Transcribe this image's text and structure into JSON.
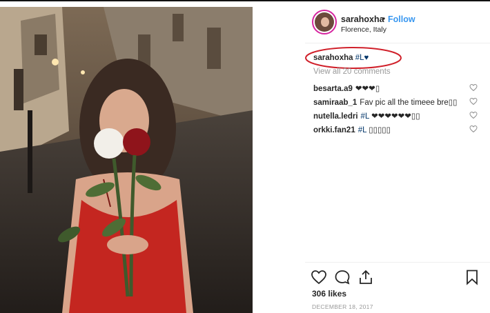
{
  "post": {
    "username": "sarahoxha",
    "follow_label": "Follow",
    "separator": "•",
    "location": "Florence, Italy",
    "caption": {
      "username": "sarahoxha",
      "text": "#L♥"
    },
    "view_all_comments": "View all 20 comments",
    "comments": [
      {
        "username": "besarta.a9",
        "text": "❤❤❤▯"
      },
      {
        "username": "samiraab_1",
        "text": "Fav pic all the timeee bre▯▯"
      },
      {
        "username": "nutella.ledri",
        "tag": "#L",
        "text": " ❤❤❤❤❤❤▯▯"
      },
      {
        "username": "orkki.fan21",
        "tag": "#L",
        "text": " ▯▯▯▯▯"
      }
    ],
    "likes": "306 likes",
    "date": "DECEMBER 18, 2017",
    "photo_description_icon": "photo-icon"
  },
  "colors": {
    "follow": "#3897f0",
    "tag": "#003569",
    "annotation": "#d0202a",
    "muted": "#999999"
  }
}
